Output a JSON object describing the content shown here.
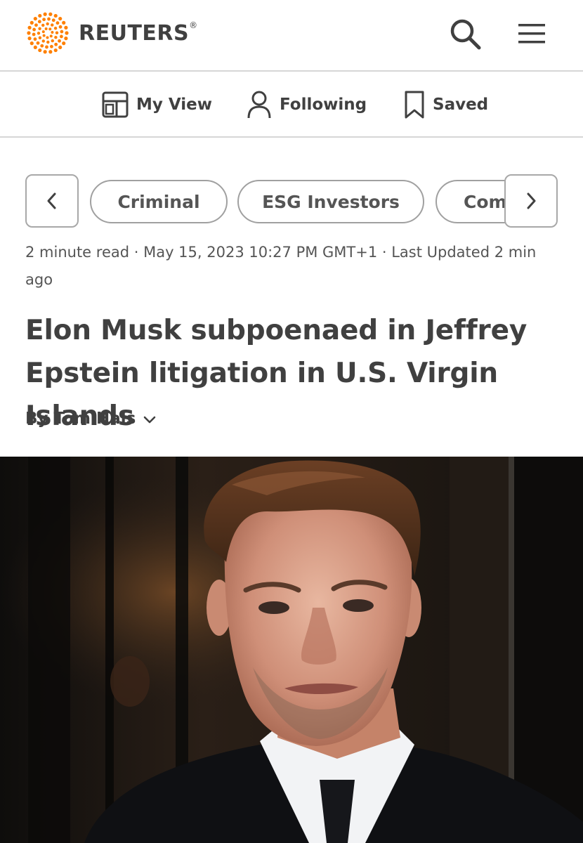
{
  "header": {
    "brand": "REUTERS",
    "brand_mark": "®",
    "logo_icon": "reuters-dot-ring-logo",
    "brand_color": "#ff8000",
    "search_icon": "search-icon",
    "menu_icon": "hamburger-menu-icon"
  },
  "nav": {
    "items": [
      {
        "label": "My View",
        "icon": "layout-icon"
      },
      {
        "label": "Following",
        "icon": "person-icon"
      },
      {
        "label": "Saved",
        "icon": "bookmark-icon"
      }
    ]
  },
  "tags": {
    "items": [
      "Criminal",
      "ESG Investors",
      "Com"
    ],
    "prev_icon": "chevron-left-icon",
    "next_icon": "chevron-right-icon"
  },
  "article": {
    "meta": "2 minute read · May 15, 2023 10:27 PM GMT+1 · Last Updated 2 min ago",
    "headline": "Elon Musk subpoenaed in Jeffrey Epstein litigation in U.S. Virgin Islands",
    "byline": "By Tom Hals",
    "byline_icon": "chevron-down-icon"
  },
  "image": {
    "subject": "portrait photo of a man in a dark suit and white shirt"
  }
}
